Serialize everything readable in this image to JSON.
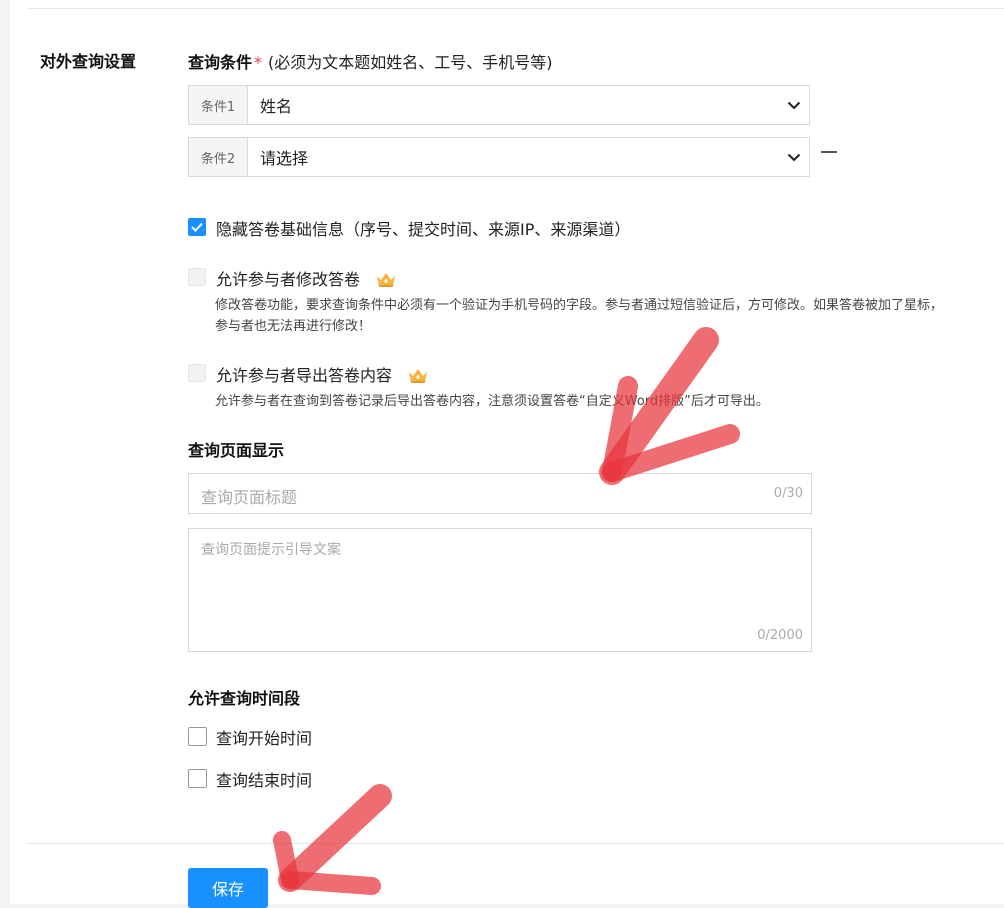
{
  "section": {
    "label": "对外查询设置"
  },
  "query_conditions": {
    "title": "查询条件",
    "required_mark": "*",
    "hint": "(必须为文本题如姓名、工号、手机号等)",
    "conditions": [
      {
        "label": "条件1",
        "value": "姓名"
      },
      {
        "label": "条件2",
        "value": "请选择"
      }
    ]
  },
  "options": {
    "hide_basic_info": {
      "label": "隐藏答卷基础信息（序号、提交时间、来源IP、来源渠道）",
      "checked": true
    },
    "allow_modify": {
      "label": "允许参与者修改答卷",
      "desc": "修改答卷功能，要求查询条件中必须有一个验证为手机号码的字段。参与者通过短信验证后，方可修改。如果答卷被加了星标，参与者也无法再进行修改！",
      "checked": false
    },
    "allow_export": {
      "label": "允许参与者导出答卷内容",
      "desc": "允许参与者在查询到答卷记录后导出答卷内容，注意须设置答卷“自定义Word排版”后才可导出。",
      "checked": false
    }
  },
  "query_page": {
    "title": "查询页面显示",
    "title_input": {
      "placeholder": "查询页面标题",
      "count": "0/30"
    },
    "guide_input": {
      "placeholder": "查询页面提示引导文案",
      "count": "0/2000"
    }
  },
  "time_period": {
    "title": "允许查询时间段",
    "start_label": "查询开始时间",
    "end_label": "查询结束时间"
  },
  "actions": {
    "save_label": "保存"
  },
  "colors": {
    "primary": "#1890ff",
    "required": "#e64545",
    "annotation": "#e8343c",
    "crown": "#f5b544"
  },
  "icons": [
    "chevron-down-icon",
    "minus-icon",
    "check-icon",
    "crown-icon"
  ]
}
